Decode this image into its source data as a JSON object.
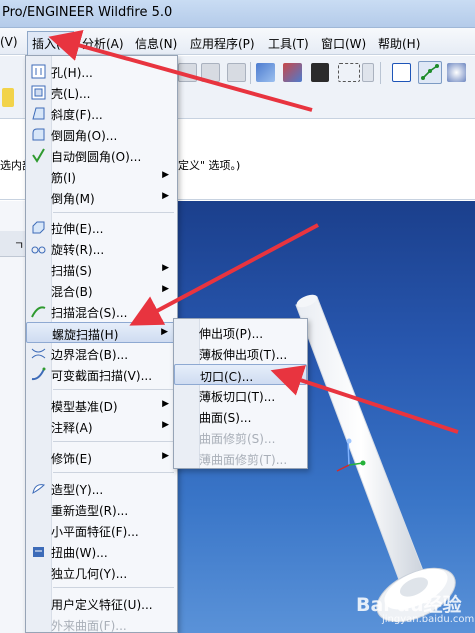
{
  "window": {
    "title": "Pro/ENGINEER Wildfire 5.0"
  },
  "menubar": {
    "items": [
      "(V)",
      "插入(I)",
      "分析(A)",
      "信息(N)",
      "应用程序(P)",
      "工具(T)",
      "窗口(W)",
      "帮助(H)"
    ],
    "active_index": 1
  },
  "message_area": {
    "line_left": "选内部",
    "line_right": "定义\" 选项。)"
  },
  "left_strip": {
    "glyph": "ㄱ"
  },
  "insert_menu": {
    "items": [
      {
        "label": "孔(H)...",
        "icon": "hole-icon",
        "submenu": false
      },
      {
        "label": "壳(L)...",
        "icon": "shell-icon",
        "submenu": false
      },
      {
        "label": "斜度(F)...",
        "icon": "draft-icon",
        "submenu": false
      },
      {
        "label": "倒圆角(O)...",
        "icon": "round-icon",
        "submenu": false
      },
      {
        "label": "自动倒圆角(O)...",
        "icon": "auto-round-icon",
        "submenu": false
      },
      {
        "label": "筋(I)",
        "icon": "",
        "submenu": true
      },
      {
        "label": "倒角(M)",
        "icon": "",
        "submenu": true
      },
      {
        "label": "拉伸(E)...",
        "icon": "extrude-icon",
        "submenu": false
      },
      {
        "label": "旋转(R)...",
        "icon": "revolve-icon",
        "submenu": false
      },
      {
        "label": "扫描(S)",
        "icon": "",
        "submenu": true
      },
      {
        "label": "混合(B)",
        "icon": "",
        "submenu": true
      },
      {
        "label": "扫描混合(S)...",
        "icon": "swept-blend-icon",
        "submenu": false
      },
      {
        "label": "螺旋扫描(H)",
        "icon": "",
        "submenu": true,
        "highlight": true
      },
      {
        "label": "边界混合(B)...",
        "icon": "boundary-blend-icon",
        "submenu": false
      },
      {
        "label": "可变截面扫描(V)...",
        "icon": "variable-section-sweep-icon",
        "submenu": false
      },
      {
        "label": "模型基准(D)",
        "icon": "",
        "submenu": true
      },
      {
        "label": "注释(A)",
        "icon": "",
        "submenu": true
      },
      {
        "label": "修饰(E)",
        "icon": "",
        "submenu": true
      },
      {
        "label": "造型(Y)...",
        "icon": "style-icon",
        "submenu": false
      },
      {
        "label": "重新造型(R)...",
        "icon": "",
        "submenu": false
      },
      {
        "label": "小平面特征(F)...",
        "icon": "",
        "submenu": false
      },
      {
        "label": "扭曲(W)...",
        "icon": "warp-icon",
        "submenu": false
      },
      {
        "label": "独立几何(Y)...",
        "icon": "",
        "submenu": false
      },
      {
        "label": "用户定义特征(U)...",
        "icon": "",
        "submenu": false
      },
      {
        "label": "外来曲面(F)...",
        "icon": "",
        "submenu": false,
        "disabled": true
      }
    ]
  },
  "helical_submenu": {
    "items": [
      {
        "label": "伸出项(P)...",
        "disabled": false
      },
      {
        "label": "薄板伸出项(T)...",
        "disabled": false
      },
      {
        "label": "切口(C)...",
        "disabled": false,
        "highlight": true
      },
      {
        "label": "薄板切口(T)...",
        "disabled": false
      },
      {
        "label": "曲面(S)...",
        "disabled": false
      },
      {
        "label": "曲面修剪(S)...",
        "disabled": true
      },
      {
        "label": "薄曲面修剪(T)...",
        "disabled": true
      }
    ]
  },
  "watermark": {
    "line1": "Bai du经验",
    "line2": "jingyan.baidu.com"
  },
  "colors": {
    "annotation_arrow": "#e8343f",
    "viewport_top": "#1b3f8c",
    "viewport_bottom": "#5a92d8"
  }
}
